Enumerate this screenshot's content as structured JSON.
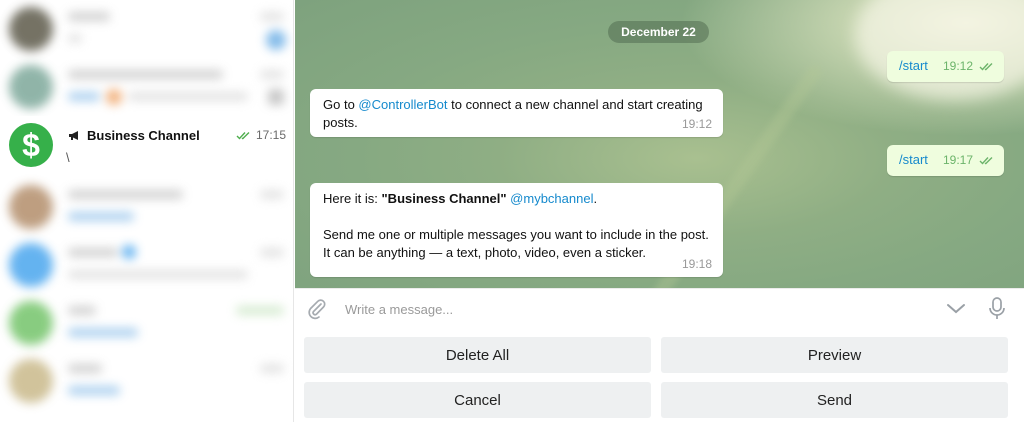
{
  "sidebar": {
    "active_chat": {
      "avatar_glyph": "$",
      "title": "Business Channel",
      "time": "17:15",
      "preview": "\\"
    }
  },
  "chat": {
    "date_label": "December 22",
    "messages": [
      {
        "dir": "out",
        "text": "/start",
        "time": "19:12"
      },
      {
        "dir": "in",
        "text_before": "Go to ",
        "link": "@ControllerBot",
        "text_after": " to connect a new channel and start creating posts.",
        "time": "19:12"
      },
      {
        "dir": "out",
        "text": "/start",
        "time": "19:17"
      },
      {
        "dir": "in",
        "prefix": "Here it is: ",
        "bold": "\"Business Channel\"",
        "link": "@mybchannel",
        "suffix": ".",
        "body": "Send me one or multiple messages you want to include in the post. It can be anything — a text, photo, video, even a sticker.",
        "time": "19:18"
      }
    ]
  },
  "input": {
    "placeholder": "Write a message..."
  },
  "keyboard": {
    "buttons": [
      "Delete All",
      "Preview",
      "Cancel",
      "Send"
    ]
  },
  "colors": {
    "accent": "#168acd",
    "avatar_green": "#36b04a",
    "outgoing_bg": "#effdde",
    "check": "#6cb46a"
  },
  "icons": [
    "megaphone-icon",
    "double-check-icon",
    "paperclip-icon",
    "chevron-down-icon",
    "microphone-icon"
  ]
}
